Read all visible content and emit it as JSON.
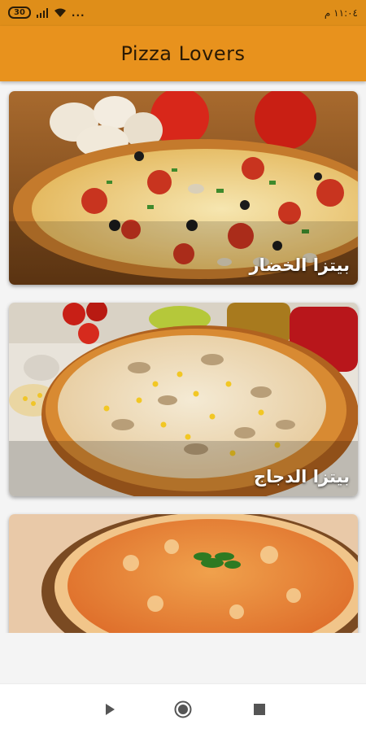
{
  "status_bar": {
    "battery": "30",
    "time": "١١:٠٤ م",
    "more": "...",
    "icons": [
      "battery-icon",
      "signal-icon",
      "wifi-icon",
      "more-dots-icon"
    ]
  },
  "app_bar": {
    "title": "Pizza Lovers",
    "color": "#e8921d"
  },
  "cards": [
    {
      "label": "بيتزا الخضار",
      "image": "vegetable-pizza-photo"
    },
    {
      "label": "بيتزا الدجاج",
      "image": "chicken-pizza-photo"
    },
    {
      "label": "",
      "image": "margherita-pizza-photo"
    }
  ],
  "nav_bar": {
    "icons": [
      "back-triangle-icon",
      "home-circle-icon",
      "recents-square-icon"
    ]
  }
}
